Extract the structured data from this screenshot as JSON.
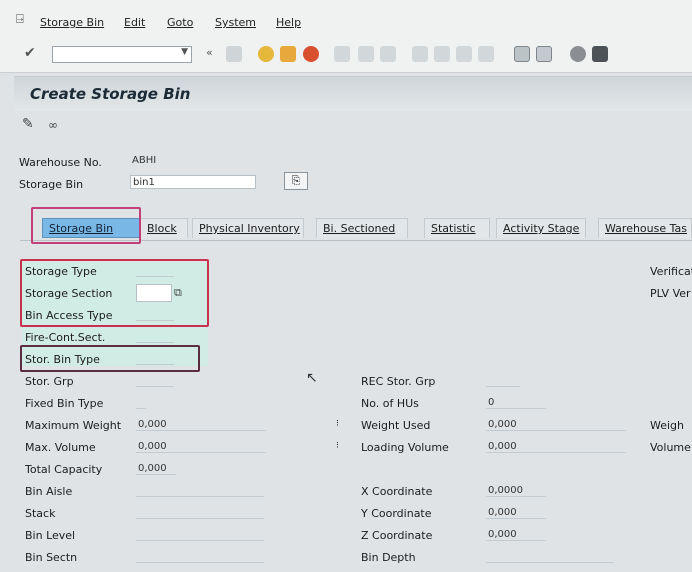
{
  "menubar": {
    "items": [
      "Storage Bin",
      "Edit",
      "Goto",
      "System",
      "Help"
    ]
  },
  "toolbar": {
    "command_value": "",
    "icons": [
      "enter-icon",
      "save-icon",
      "back-icon",
      "exit-icon",
      "cancel-icon",
      "print-icon",
      "find-icon",
      "find-next-icon",
      "first-page-icon",
      "prev-page-icon",
      "next-page-icon",
      "last-page-icon",
      "create-session-icon",
      "shortcut-icon",
      "help-icon",
      "customize-icon"
    ]
  },
  "title": "Create Storage Bin",
  "header": {
    "warehouse_label": "Warehouse No.",
    "warehouse_value": "ABHI",
    "bin_label": "Storage Bin",
    "bin_value": "bin1"
  },
  "tabs": [
    "Storage Bin",
    "Block",
    "Physical Inventory",
    "Bi. Sectioned",
    "Statistic",
    "Activity Stage",
    "Warehouse Tas"
  ],
  "fields": {
    "storage_type": "Storage Type",
    "storage_section": "Storage Section",
    "bin_access_type": "Bin Access Type",
    "fire_cont_sect": "Fire-Cont.Sect.",
    "stor_bin_type": "Stor. Bin Type",
    "stor_grp": "Stor. Grp",
    "fixed_bin_type": "Fixed Bin Type",
    "max_weight": "Maximum Weight",
    "max_weight_value": "0,000",
    "max_volume": "Max. Volume",
    "max_volume_value": "0,000",
    "total_capacity": "Total Capacity",
    "total_capacity_value": "0,000",
    "bin_aisle": "Bin Aisle",
    "stack": "Stack",
    "bin_level": "Bin Level",
    "bin_sectn": "Bin Sectn",
    "rec_stor_grp": "REC Stor. Grp",
    "no_of_hus": "No. of HUs",
    "no_of_hus_value": "0",
    "weight_used": "Weight Used",
    "weight_used_value": "0,000",
    "loading_volume": "Loading Volume",
    "loading_volume_value": "0,000",
    "x_coordinate": "X Coordinate",
    "x_value": "0,0000",
    "y_coordinate": "Y Coordinate",
    "y_value": "0,000",
    "z_coordinate": "Z Coordinate",
    "z_value": "0,000",
    "bin_depth": "Bin Depth",
    "verification": "Verificati",
    "plv_ver": "PLV Ver",
    "weight_right": "Weigh",
    "volume_right": "Volume"
  }
}
